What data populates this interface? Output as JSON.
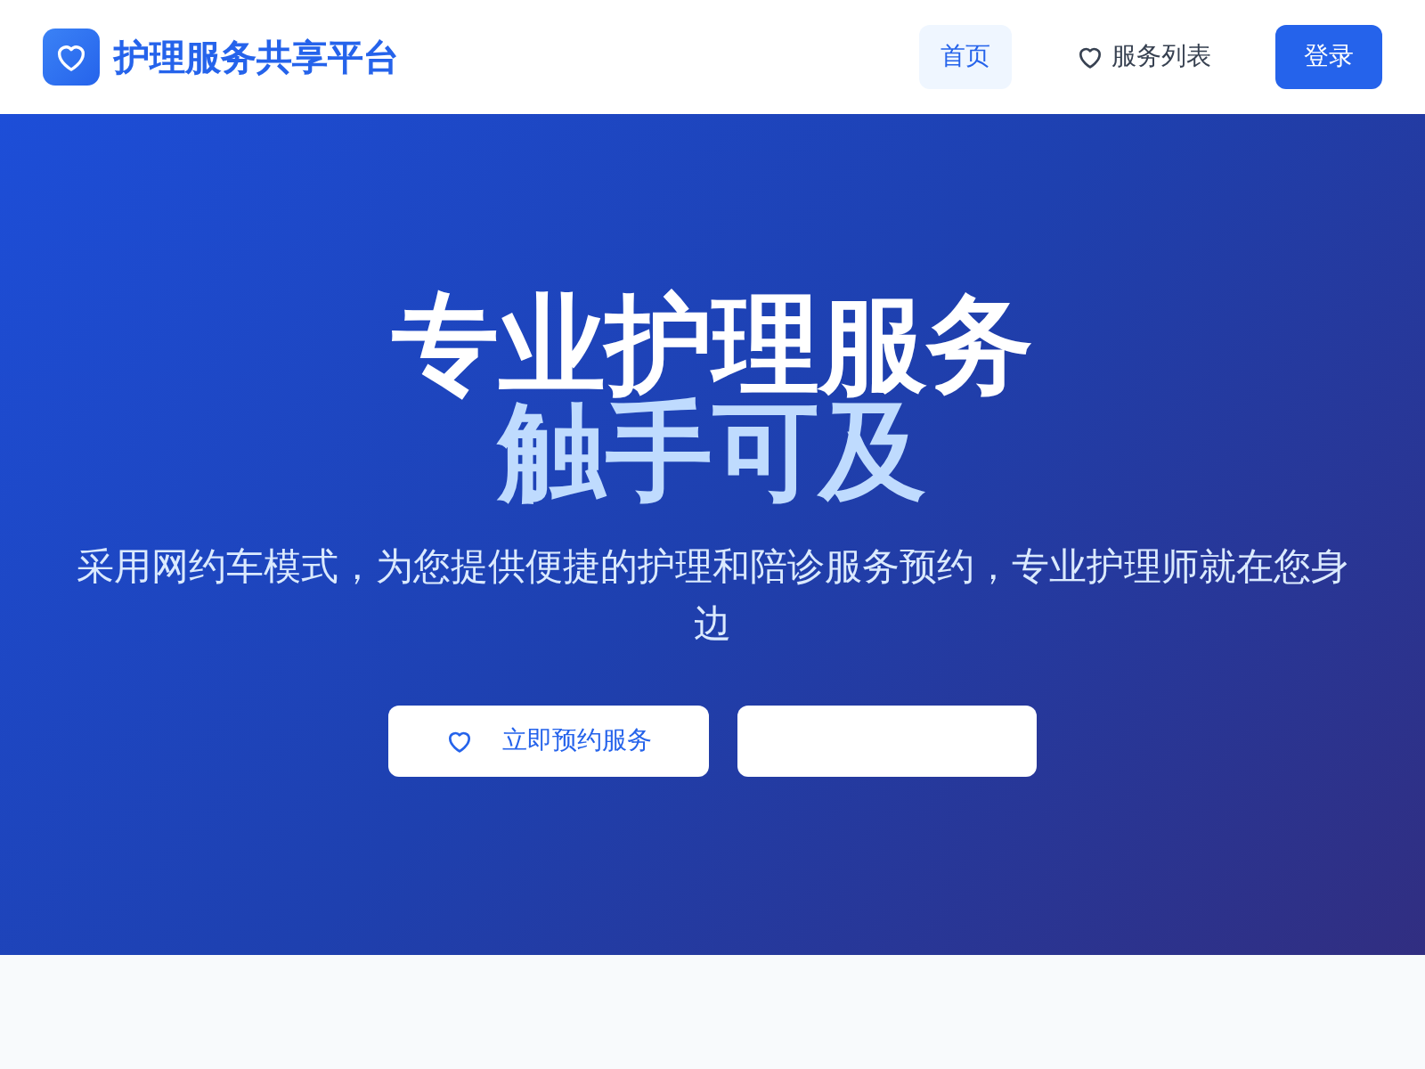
{
  "header": {
    "brand": "护理服务共享平台",
    "nav": [
      {
        "label": "首页",
        "selected": true,
        "icon": false
      },
      {
        "label": "服务列表",
        "selected": false,
        "icon": true
      }
    ],
    "login": "登录"
  },
  "hero": {
    "title": "专业护理服务",
    "subtitle": "触手可及",
    "description": "采用网约车模式，为您提供便捷的护理和陪诊服务预约，专业护理师就在您身边",
    "buttons": [
      {
        "kind": "primary",
        "label": "立即预约服务"
      },
      {
        "kind": "blank"
      }
    ]
  }
}
